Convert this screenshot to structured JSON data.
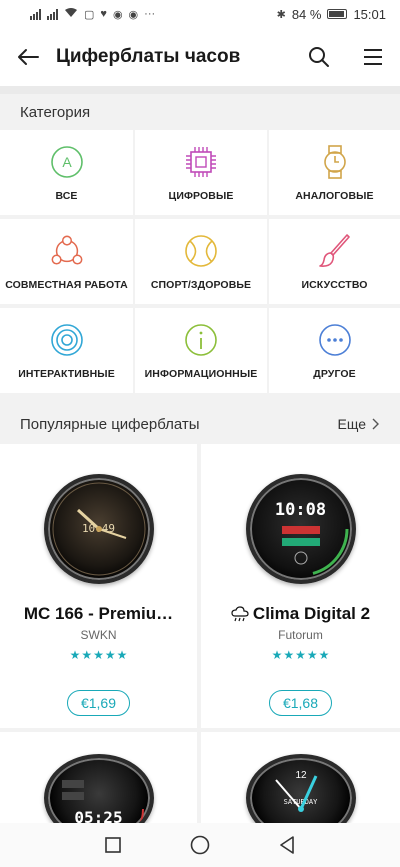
{
  "status": {
    "battery": "84 %",
    "time": "15:01"
  },
  "appbar": {
    "title": "Циферблаты часов"
  },
  "categories_header": "Категория",
  "categories": [
    {
      "label": "ВСЕ",
      "icon": "letter-a-circle-icon",
      "color": "#5fbf6a"
    },
    {
      "label": "ЦИФРОВЫЕ",
      "icon": "chip-icon",
      "color": "#c04ab8"
    },
    {
      "label": "АНАЛОГОВЫЕ",
      "icon": "wristwatch-icon",
      "color": "#d1a54a"
    },
    {
      "label": "СОВМЕСТНАЯ РАБОТА",
      "icon": "collaboration-icon",
      "color": "#e36a4f"
    },
    {
      "label": "СПОРТ/ЗДОРОВЬЕ",
      "icon": "tennis-ball-icon",
      "color": "#e3b83a"
    },
    {
      "label": "ИСКУССТВО",
      "icon": "paint-brush-icon",
      "color": "#e0567a"
    },
    {
      "label": "ИНТЕРАКТИВНЫЕ",
      "icon": "concentric-circles-icon",
      "color": "#31a7d6"
    },
    {
      "label": "ИНФОРМАЦИОННЫЕ",
      "icon": "info-icon",
      "color": "#8cbf3a"
    },
    {
      "label": "ДРУГОЕ",
      "icon": "more-dots-icon",
      "color": "#4c7fd6"
    }
  ],
  "popular": {
    "header": "Популярные циферблаты",
    "more_label": "Еще",
    "cards": [
      {
        "name": "MC 166 - Premiu…",
        "developer": "SWKN",
        "rating_stars": 5,
        "price": "€1,69",
        "face_time": "10:49"
      },
      {
        "name": "Clima Digital 2",
        "developer": "Futorum",
        "rating_stars": 5,
        "price": "€1,68",
        "face_time": "10:08",
        "name_icon": "weather-cloud-icon"
      },
      {
        "face_time": "05:25"
      },
      {
        "face_day": "SATURDAY"
      }
    ]
  },
  "accent_color": "#19a9b8"
}
